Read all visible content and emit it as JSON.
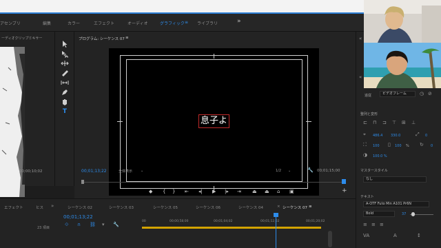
{
  "workspace_tabs": [
    "アセンブリ",
    "編集",
    "カラー",
    "エフェクト",
    "オーディオ",
    "グラフィック",
    "ライブラリ"
  ],
  "active_workspace": "グラフィック",
  "more_glyph": "»",
  "source_panel": {
    "title": "ーディオクリップミキサー",
    "timecode": "00;00;10;02"
  },
  "program": {
    "title": "プログラム: シーケンス 07",
    "menu_glyph": "≡",
    "overlay_text": "息子よ",
    "timecode": "00;01;13;22",
    "fit": "全体表示",
    "resolution": "1/2",
    "duration": "00;01;15;00"
  },
  "project_panel": {
    "tabs": [
      "エフェクト",
      "ヒス"
    ],
    "item_count": "23 項目"
  },
  "timeline": {
    "tabs": [
      "シーケンス 02",
      "シーケンス 03",
      "シーケンス 05",
      "シーケンス 06",
      "シーケンス 04",
      "シーケンス 07"
    ],
    "active_tab": "シーケンス 07",
    "timecode": "00;01;13;22",
    "ruler": [
      "00",
      "00;00;58;00",
      "00;01;04;02",
      "00;01;12;02",
      "00;01;20;02"
    ]
  },
  "essential_graphics": {
    "source_label": "追従",
    "source_value": "ビデオフレーム",
    "align_label": "整列と変形",
    "position_x": "486.4",
    "position_y": "330.0",
    "rotation": "0",
    "scale": "100",
    "opacity": "100.0 %",
    "percent": "%",
    "master_style_label": "マスタースタイル",
    "master_style_value": "なし",
    "text_label": "テキスト",
    "font": "A-OTF Futo Min A101 Pr6N",
    "weight": "Bold",
    "size": "37"
  },
  "colors": {
    "accent": "#2d8ceb",
    "work_area": "#d3a300",
    "title_box": "#c02a2a"
  }
}
